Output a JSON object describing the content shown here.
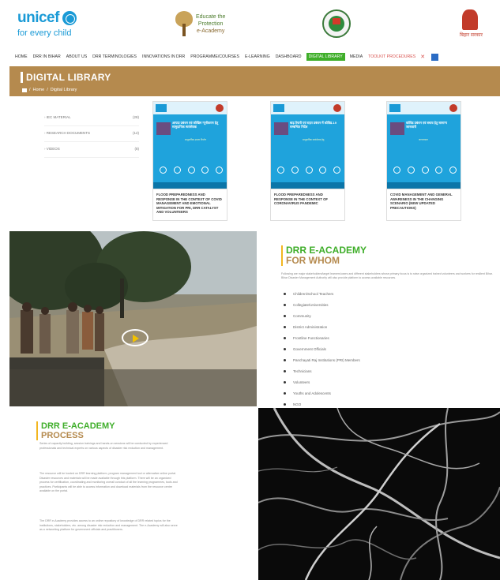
{
  "header": {
    "brand": "unicef",
    "tagline": "for every child",
    "academy_line1": "Educate the",
    "academy_line2": "Protection",
    "academy_line3": "e-Academy",
    "seal2_label": "बिहार सरकार"
  },
  "nav": {
    "items": [
      {
        "label": "Home",
        "active": false
      },
      {
        "label": "DRR in Bihar",
        "active": false
      },
      {
        "label": "About us",
        "active": false
      },
      {
        "label": "DRR Terminologies",
        "active": false
      },
      {
        "label": "Innovations in DRR",
        "active": false
      },
      {
        "label": "Programme/Courses",
        "active": false
      },
      {
        "label": "E-Learning",
        "active": false
      },
      {
        "label": "Dashboard",
        "active": false
      },
      {
        "label": "Digital Library",
        "active": true
      },
      {
        "label": "Media",
        "active": false
      },
      {
        "label": "Toolkit Procedures",
        "active": false,
        "highlight": true
      }
    ]
  },
  "banner": {
    "title": "DIGITAL LIBRARY",
    "crumb_home": "Home",
    "crumb_sep": "/",
    "crumb_current": "Digital Library"
  },
  "categories": [
    {
      "name": "IEC MATERIAL",
      "count": "(28)"
    },
    {
      "name": "RESEARCH DOCUMENTS",
      "count": "(12)"
    },
    {
      "name": "VIDEOS",
      "count": "(8)"
    }
  ],
  "books": [
    {
      "cover_title": "आपदा प्रबंधन एवं जोखिम न्यूनीकरण हेतु सामुदायिक स्वयंसेवक",
      "cover_sub": "सामुदायिक क्षमता निर्माण",
      "caption": "FLOOD PREPAREDNESS AND RESPONSE IN THE CONTEXT OF COVID MANAGEMENT AND EMOTIONAL MITIGATION FOR PRI, DRR CATALYST AND VOLUNTEERS"
    },
    {
      "cover_title": "बाढ़ तैयारी एवं राहत प्रबंधन में कोविड-19 सम्बन्धित निर्देश",
      "cover_sub": "सामुदायिक स्वयंसेवक हेतु",
      "caption": "FLOOD PREPAREDNESS AND RESPONSE IN THE CONTEXT OF CORONAVIRUS PANDEMIC"
    },
    {
      "cover_title": "कोविड प्रबंधन एवं बचाव हेतु सामान्य जानकारी",
      "cover_sub": "जागरूकता",
      "caption": "COVID MANAGEMENT AND GENERAL AWARENESS IN THE CHANGING SCENARIO (NEW UPDATED PRECAUTIONS)"
    }
  ],
  "whom": {
    "title_line1": "DRR E-ACADEMY",
    "title_line2": "FOR WHOM",
    "intro": "Following are major stakeholders/target learners/users and different stakeholders whose primary focus is to raise organized trained volunteers and workers for resilient Bihar. Bihar Disaster Management Authority will also provide platform to access available resources.",
    "audience": [
      "Children/School Teachers",
      "Collegiate/Universities",
      "Community",
      "District Administration",
      "Frontline Functionaries",
      "Government Officials",
      "Panchayati Raj Institutions (PRI) Members",
      "Technicians",
      "Volunteers",
      "Youths and Adolescents",
      "NGO"
    ]
  },
  "process": {
    "title_line1": "DRR E-ACADEMY",
    "title_line2": "PROCESS",
    "paragraphs": [
      "Series of capacity building, session trainings and hands-on sessions will be conducted by experienced professionals and technical experts on various aspects of disaster risk reduction and management.",
      "The resource will be hosted on DRR learning platform, program management tool or alternative online portal. Disaster resources and materials will be made available through this platform. There will be an organized process for certification, coordinating and monitoring overall conduct of all the learning programmes, tools and practices. Participants will be able to access information and download materials from the resource centre available on the portal.",
      "The DRR e-Academy provides access to an online repository of knowledge of DRR related topics for the institutions, stakeholders, etc. among disaster risk reduction and management. The e-Academy will also serve as a networking platform for government officials and practitioners."
    ]
  },
  "colors": {
    "brand_blue": "#1a9ad6",
    "banner_brown": "#b58a4e",
    "accent_green": "#3fae2a",
    "accent_gold": "#f2b620"
  },
  "icons": {
    "home": "home-icon",
    "globe": "unicef-globe-icon",
    "play": "play-icon"
  }
}
